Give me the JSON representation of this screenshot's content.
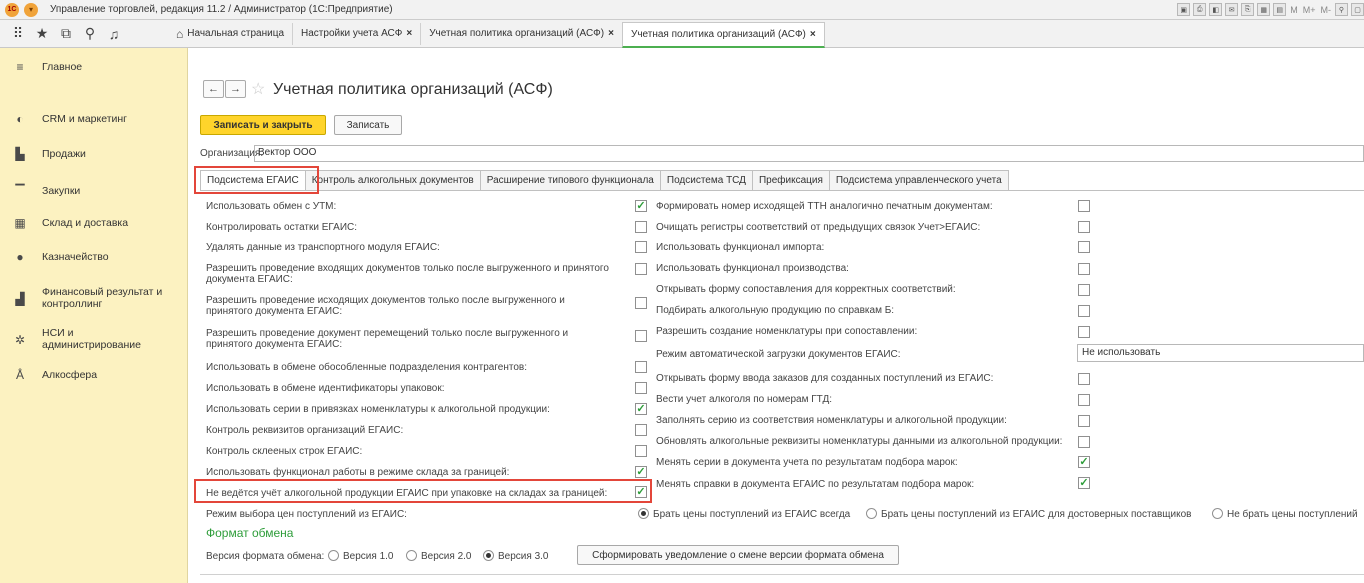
{
  "window": {
    "title": "Управление торговлей, редакция 11.2 / Администратор  (1С:Предприятие)",
    "logo": "1С",
    "menu_icon": "chevron-down-icon"
  },
  "toolbar_icons": [
    "save-icon",
    "print-icon",
    "preview-icon",
    "email-icon",
    "attach-icon",
    "table-icon",
    "calendar-icon",
    "M",
    "M+",
    "M-",
    "zoom-icon",
    "window-icon"
  ],
  "tabbar": {
    "icons": [
      "apps-grid-icon",
      "favorites-star-icon",
      "history-icon",
      "search-icon",
      "notifications-bell-icon"
    ],
    "home_label": "Начальная страница",
    "tabs": [
      {
        "label": "Настройки учета АСФ",
        "close": "×"
      },
      {
        "label": "Учетная политика организаций (АСФ)",
        "close": "×"
      },
      {
        "label": "Учетная политика организаций (АСФ)",
        "close": "×",
        "active": true
      }
    ]
  },
  "sidebar": {
    "items": [
      {
        "label": "Главное",
        "icon": "menu-lines-icon"
      },
      {
        "label": "CRM и маркетинг",
        "icon": "crm-icon"
      },
      {
        "label": "Продажи",
        "icon": "sales-bag-icon"
      },
      {
        "label": "Закупки",
        "icon": "cart-icon"
      },
      {
        "label": "Склад и доставка",
        "icon": "warehouse-icon"
      },
      {
        "label": "Казначейство",
        "icon": "treasury-icon"
      },
      {
        "label": "Финансовый результат и контроллинг",
        "icon": "chart-icon"
      },
      {
        "label": "НСИ и администрирование",
        "icon": "gear-icon"
      },
      {
        "label": "Алкосфера",
        "icon": "bottle-icon"
      }
    ]
  },
  "page": {
    "title": "Учетная политика организаций (АСФ)",
    "save_close_label": "Записать и закрыть",
    "save_label": "Записать",
    "org_label": "Организация:",
    "org_value": "Вектор ООО",
    "form_tabs": [
      "Подсистема ЕГАИС",
      "Контроль алкогольных документов",
      "Расширение типового функционала",
      "Подсистема ТСД",
      "Префиксация",
      "Подсистема управленческого учета"
    ]
  },
  "left_settings": [
    {
      "label": "Использовать обмен с УТМ:",
      "checked": true
    },
    {
      "label": "Контролировать остатки ЕГАИС:",
      "checked": false
    },
    {
      "label": "Удалять данные из транспортного модуля ЕГАИС:",
      "checked": false
    },
    {
      "label": "Разрешить проведение входящих документов только после выгруженного и принятого документа ЕГАИС:",
      "checked": false
    },
    {
      "label": "Разрешить проведение исходящих документов только после выгруженного и принятого документа ЕГАИС:",
      "checked": false
    },
    {
      "label": "Разрешить проведение документ перемещений только после выгруженного и принятого документа ЕГАИС:",
      "checked": false
    },
    {
      "label": "Использовать в обмене обособленные подразделения контрагентов:",
      "checked": false
    },
    {
      "label": "Использовать в обмене идентификаторы упаковок:",
      "checked": false
    },
    {
      "label": "Использовать серии в привязках номенклатуры к алкогольной продукции:",
      "checked": true
    },
    {
      "label": "Контроль реквизитов организаций ЕГАИС:",
      "checked": false
    },
    {
      "label": "Контроль склееных строк ЕГАИС:",
      "checked": false
    },
    {
      "label": "Использовать функционал работы в режиме склада за границей:",
      "checked": true
    },
    {
      "label": "Не ведётся учёт алкогольной продукции ЕГАИС при упаковке на складах за границей:",
      "checked": true
    }
  ],
  "right_settings": [
    {
      "label": "Формировать номер исходящей ТТН аналогично печатным документам:",
      "checked": false
    },
    {
      "label": "Очищать регистры соответствий от предыдущих связок Учет>ЕГАИС:",
      "checked": false
    },
    {
      "label": "Использовать функционал импорта:",
      "checked": false
    },
    {
      "label": "Использовать функционал производства:",
      "checked": false
    },
    {
      "label": "Открывать форму сопоставления для корректных соответствий:",
      "checked": false
    },
    {
      "label": "Подбирать алкогольную продукцию по справкам Б:",
      "checked": false
    },
    {
      "label": "Разрешить создание номенклатуры при сопоставлении:",
      "checked": false
    },
    {
      "label": "Режим автоматической загрузки документов ЕГАИС:",
      "value": "Не использовать"
    },
    {
      "label": "Открывать форму ввода заказов для созданных поступлений из ЕГАИС:",
      "checked": false
    },
    {
      "label": "Вести учет алкоголя по номерам ГТД:",
      "checked": false
    },
    {
      "label": "Заполнять серию из соответствия номенклатуры и алкогольной продукции:",
      "checked": false
    },
    {
      "label": "Обновлять алкогольные реквизиты номенклатуры данными из алкогольной продукции:",
      "checked": false
    },
    {
      "label": "Менять серии в документа учета по результатам подбора марок:",
      "checked": true
    },
    {
      "label": "Менять справки в документа ЕГАИС по результатам подбора марок:",
      "checked": true
    }
  ],
  "price_mode": {
    "label": "Режим выбора цен поступлений из ЕГАИС:",
    "options": [
      {
        "label": "Брать цены поступлений из ЕГАИС всегда",
        "selected": true
      },
      {
        "label": "Брать цены поступлений из ЕГАИС для достоверных поставщиков",
        "selected": false
      },
      {
        "label": "Не брать цены поступлений",
        "selected": false
      }
    ]
  },
  "exchange_format": {
    "title": "Формат обмена",
    "version_label": "Версия формата обмена:",
    "versions": [
      {
        "label": "Версия 1.0",
        "selected": false
      },
      {
        "label": "Версия 2.0",
        "selected": false
      },
      {
        "label": "Версия 3.0",
        "selected": true
      }
    ],
    "notify_button": "Сформировать уведомление о смене версии формата обмена"
  },
  "colors": {
    "sidebar_bg": "#fcf2c1",
    "primary_button": "#ffd42b",
    "check": "#2e9d3a",
    "highlight": "#e3463a",
    "accent_green": "#4caf50"
  }
}
